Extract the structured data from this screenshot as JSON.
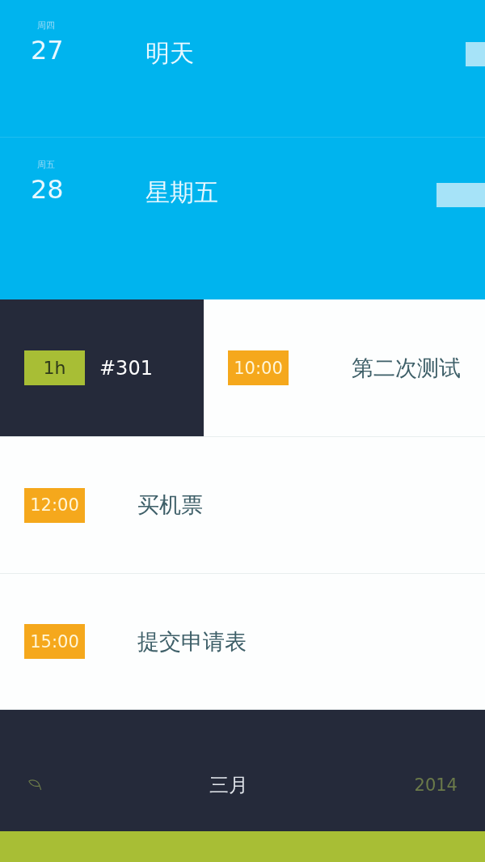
{
  "days": [
    {
      "weekday": "周四",
      "date": "27",
      "title": "明天",
      "level": 0.04
    },
    {
      "weekday": "周五",
      "date": "28",
      "title": "星期五",
      "level": 0.1
    }
  ],
  "events": [
    {
      "kind": "detail",
      "duration": "1h",
      "number": "#301",
      "time": "10:00",
      "title": "第二次测试"
    },
    {
      "kind": "plain",
      "time": "12:00",
      "title": "买机票"
    },
    {
      "kind": "plain",
      "time": "15:00",
      "title": "提交申请表"
    }
  ],
  "footer": {
    "month": "三月",
    "year": "2014"
  }
}
